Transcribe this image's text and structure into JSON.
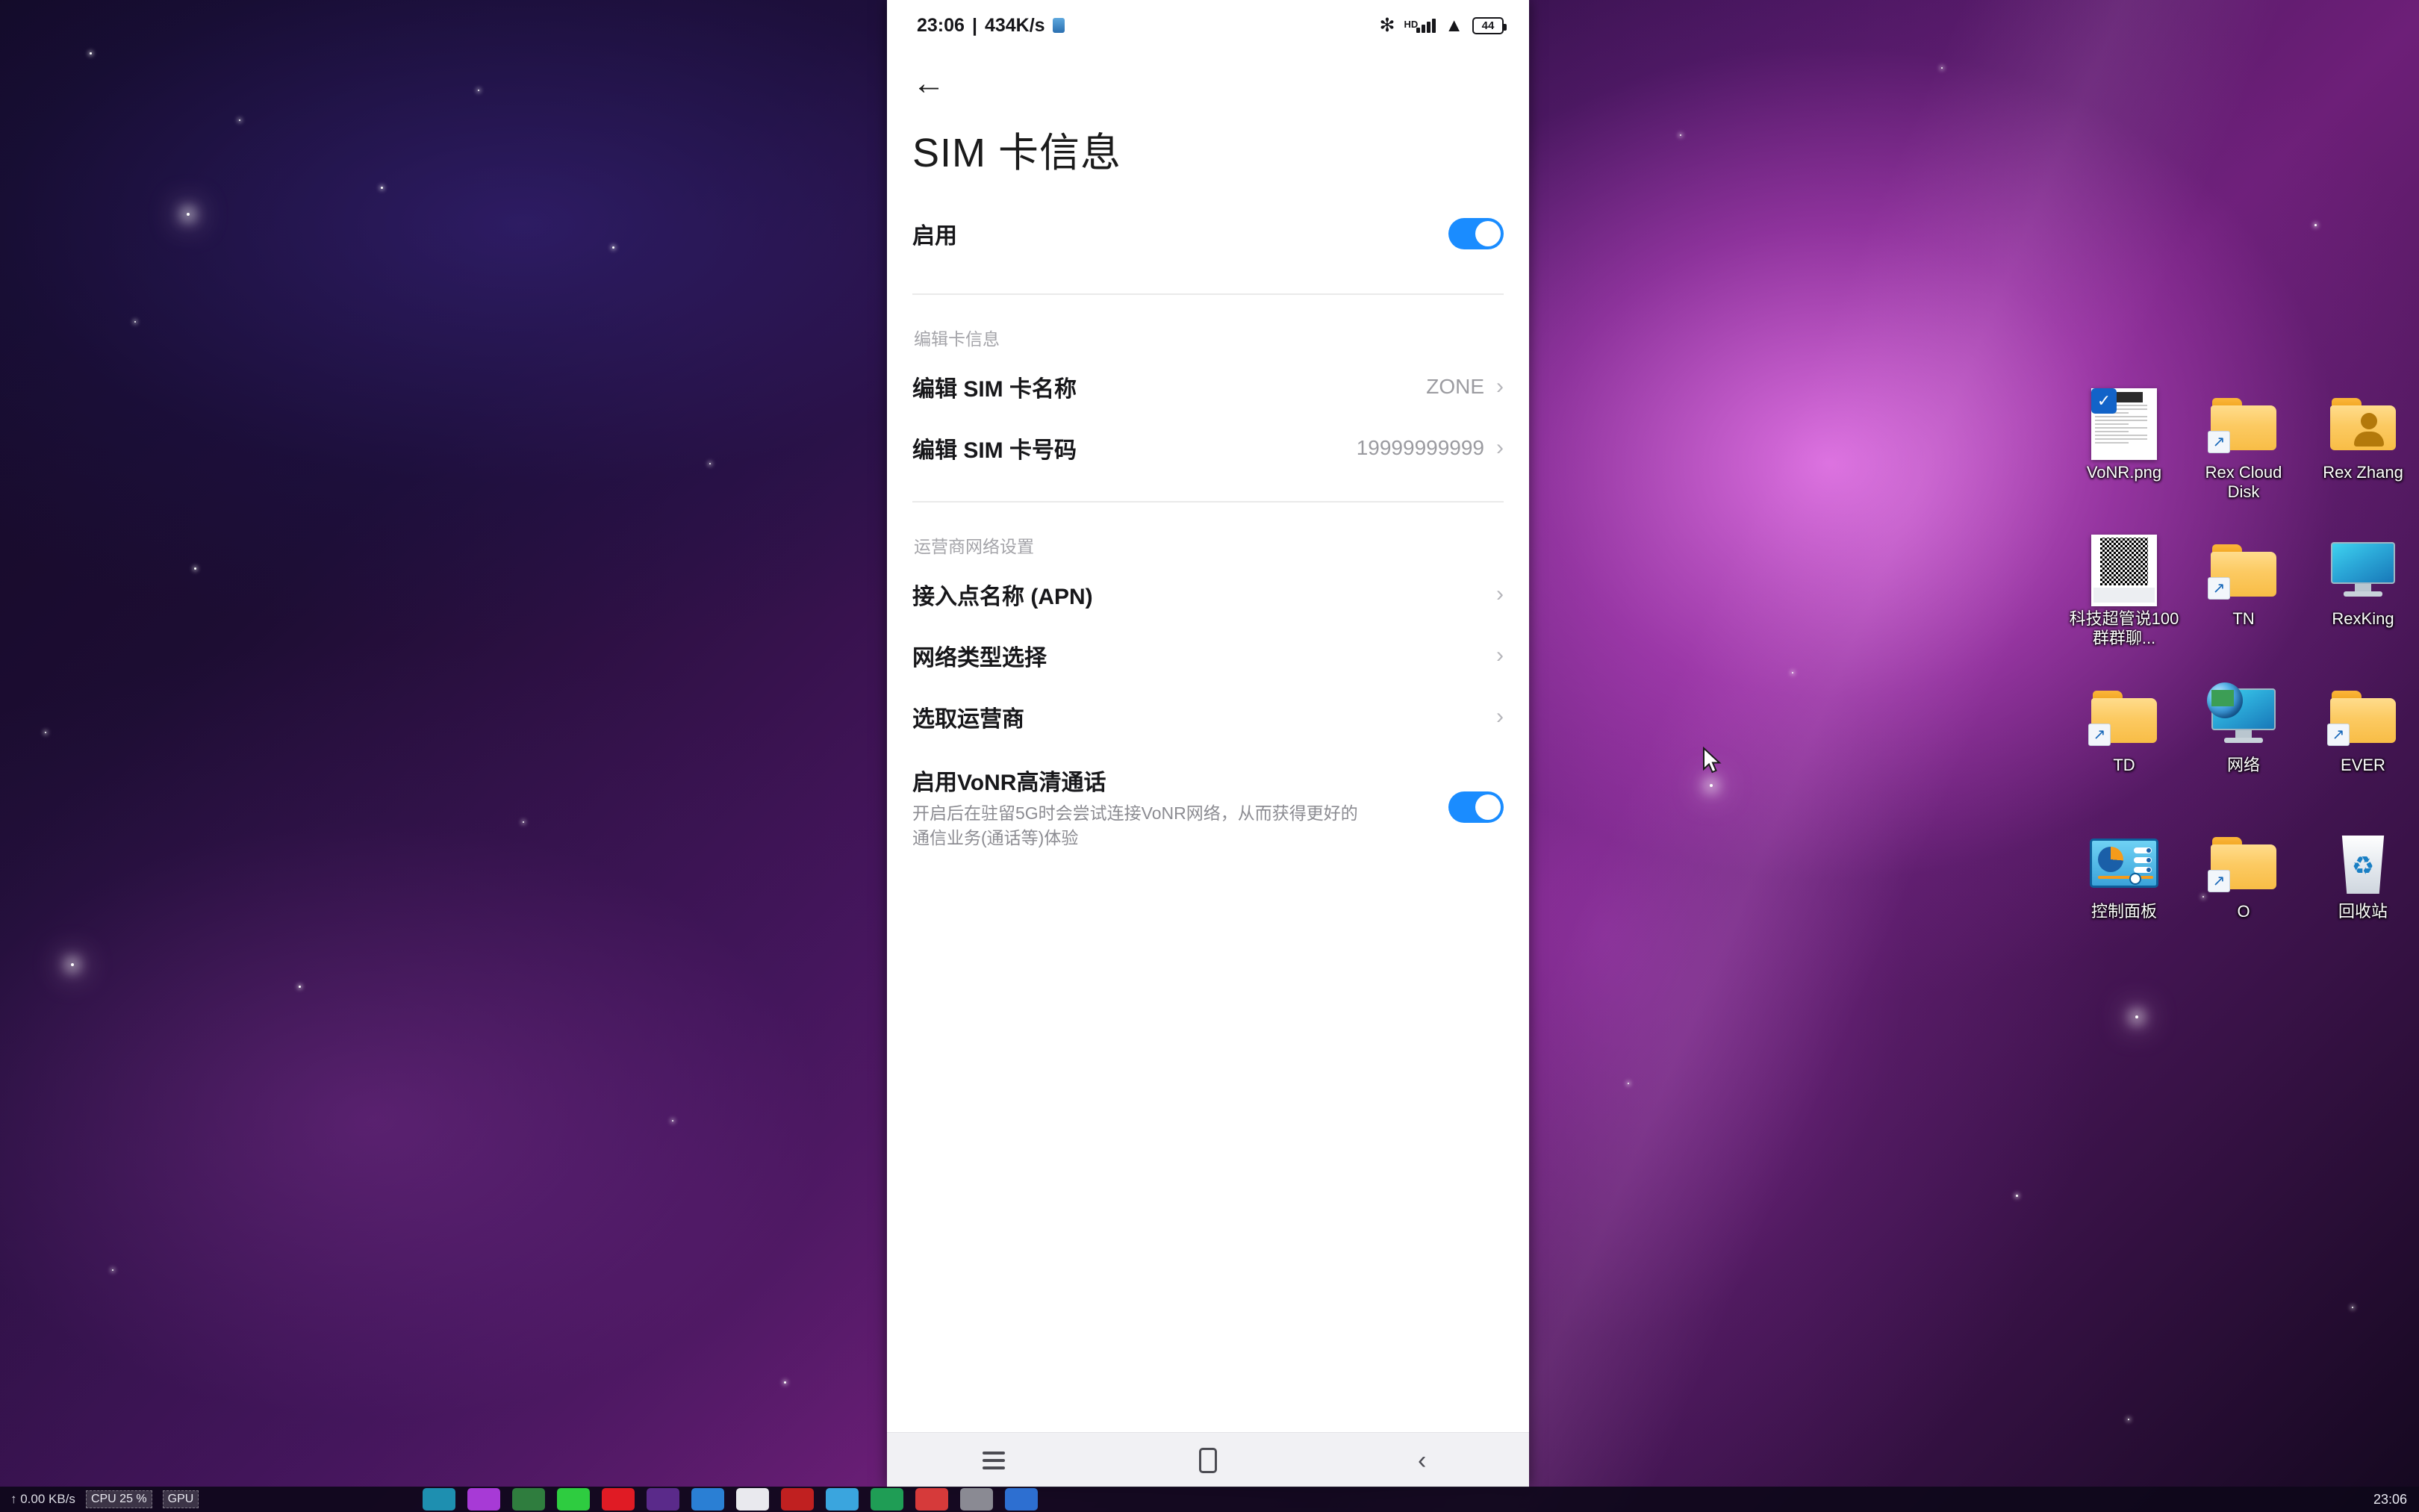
{
  "desktop": {
    "icons": [
      {
        "label": "VoNR.png",
        "type": "image-file",
        "shortcut": false
      },
      {
        "label": "Rex Cloud Disk",
        "type": "folder",
        "shortcut": true
      },
      {
        "label": "Rex Zhang",
        "type": "user-folder",
        "shortcut": false
      },
      {
        "label": "科技超管说100群群聊...",
        "type": "image-file-qr",
        "shortcut": false
      },
      {
        "label": "TN",
        "type": "folder",
        "shortcut": true
      },
      {
        "label": "RexKing",
        "type": "computer",
        "shortcut": false
      },
      {
        "label": "TD",
        "type": "folder",
        "shortcut": true
      },
      {
        "label": "网络",
        "type": "network",
        "shortcut": false
      },
      {
        "label": "EVER",
        "type": "folder",
        "shortcut": true
      },
      {
        "label": "控制面板",
        "type": "control-panel",
        "shortcut": false
      },
      {
        "label": "O",
        "type": "folder",
        "shortcut": true
      },
      {
        "label": "回收站",
        "type": "recycle-bin",
        "shortcut": false
      }
    ]
  },
  "phone": {
    "status_bar": {
      "time": "23:06",
      "separator": "|",
      "network_speed": "434K/s",
      "hd_label": "HD",
      "battery_level": "44"
    },
    "back_icon": "←",
    "title": "SIM 卡信息",
    "enable_row": {
      "label": "启用",
      "toggle_on": true
    },
    "section_edit_card": {
      "header": "编辑卡信息",
      "rows": [
        {
          "label": "编辑 SIM 卡名称",
          "value": "ZONE",
          "chevron": "›"
        },
        {
          "label": "编辑 SIM 卡号码",
          "value": "19999999999",
          "chevron": "›"
        }
      ]
    },
    "section_operator": {
      "header": "运营商网络设置",
      "rows": [
        {
          "label": "接入点名称 (APN)",
          "value": "",
          "chevron": "›"
        },
        {
          "label": "网络类型选择",
          "value": "",
          "chevron": "›"
        },
        {
          "label": "选取运营商",
          "value": "",
          "chevron": "›"
        }
      ]
    },
    "vonr": {
      "title": "启用VoNR高清通话",
      "description": "开启后在驻留5G时会尝试连接VoNR网络，从而获得更好的通信业务(通话等)体验",
      "toggle_on": true
    },
    "nav_bar": {
      "menu": "menu-icon",
      "home": "home-icon",
      "back": "back-icon"
    }
  },
  "taskbar": {
    "upload_speed": "↑ 0.00 KB/s",
    "cpu_label": "CPU 25 %",
    "cpu_label2": "GPU",
    "clock": "23:06"
  },
  "colors": {
    "toggle_on": "#1a8cff",
    "accent_blue": "#1263c8",
    "folder_yellow": "#fcca62",
    "text_primary": "#17171a",
    "text_muted": "#9b9ba0"
  }
}
